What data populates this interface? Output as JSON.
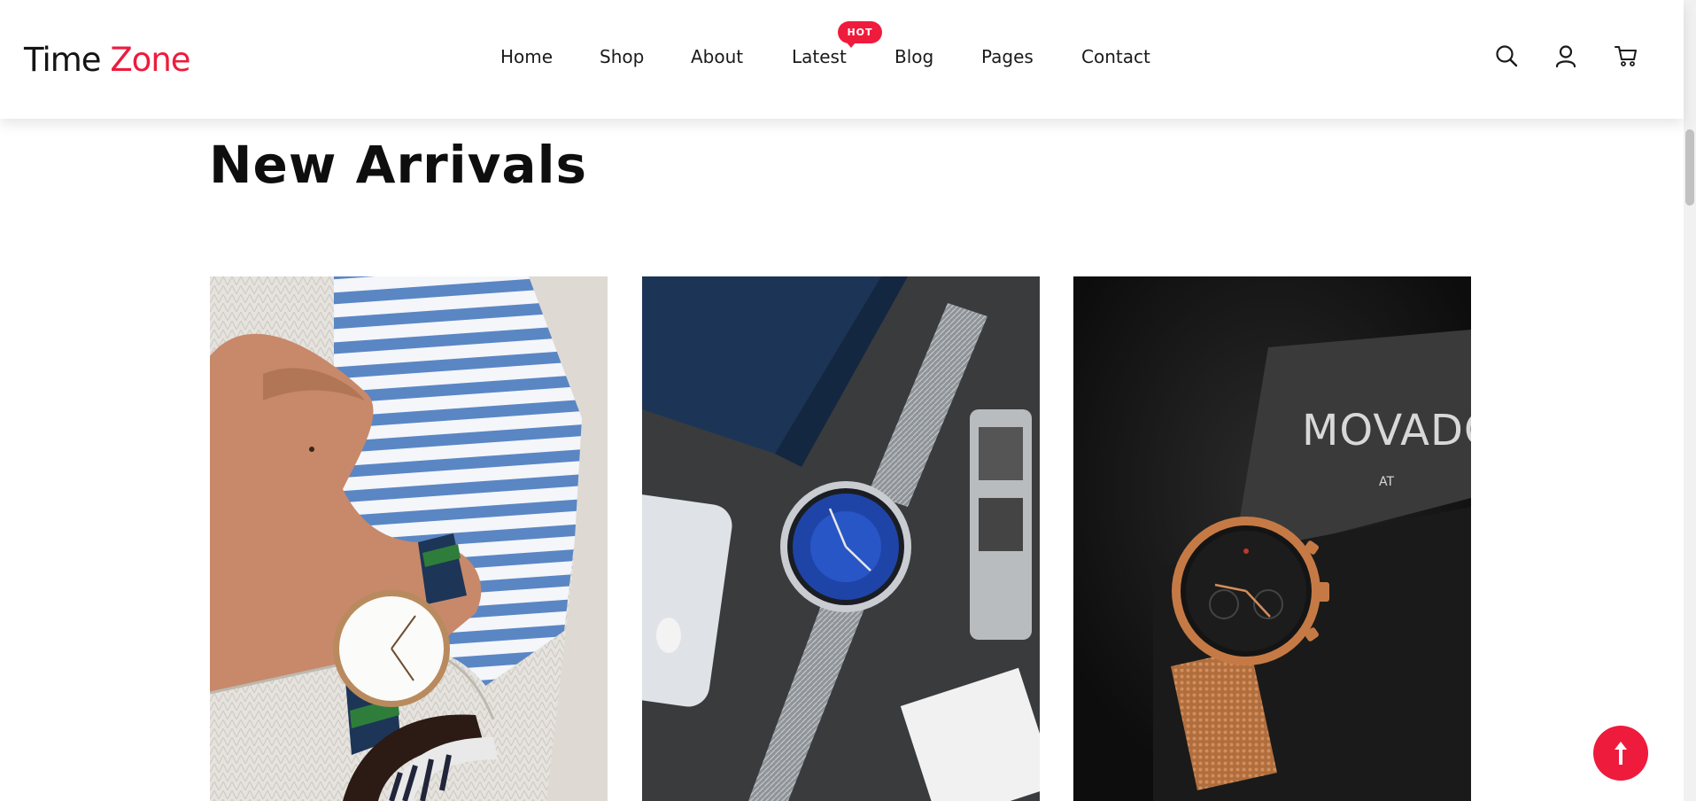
{
  "brand": {
    "name_part1": "Time",
    "name_part2": "Zone"
  },
  "nav": {
    "items": [
      {
        "label": "Home"
      },
      {
        "label": "Shop"
      },
      {
        "label": "About"
      },
      {
        "label": "Latest"
      },
      {
        "label": "Blog"
      },
      {
        "label": "Pages"
      },
      {
        "label": "Contact"
      }
    ],
    "badge": "HOT"
  },
  "header_icons": [
    "search-icon",
    "user-icon",
    "cart-icon"
  ],
  "section": {
    "title": "New Arrivals"
  },
  "products": [
    {
      "image": "watch-on-wrist-striped-shirt"
    },
    {
      "image": "blue-dial-mesh-watch"
    },
    {
      "image": "rose-gold-watch-box",
      "box_text": "MOVADO",
      "box_subtext": "AT"
    }
  ],
  "colors": {
    "accent": "#ee1b3d",
    "text": "#111111",
    "background": "#ffffff"
  }
}
